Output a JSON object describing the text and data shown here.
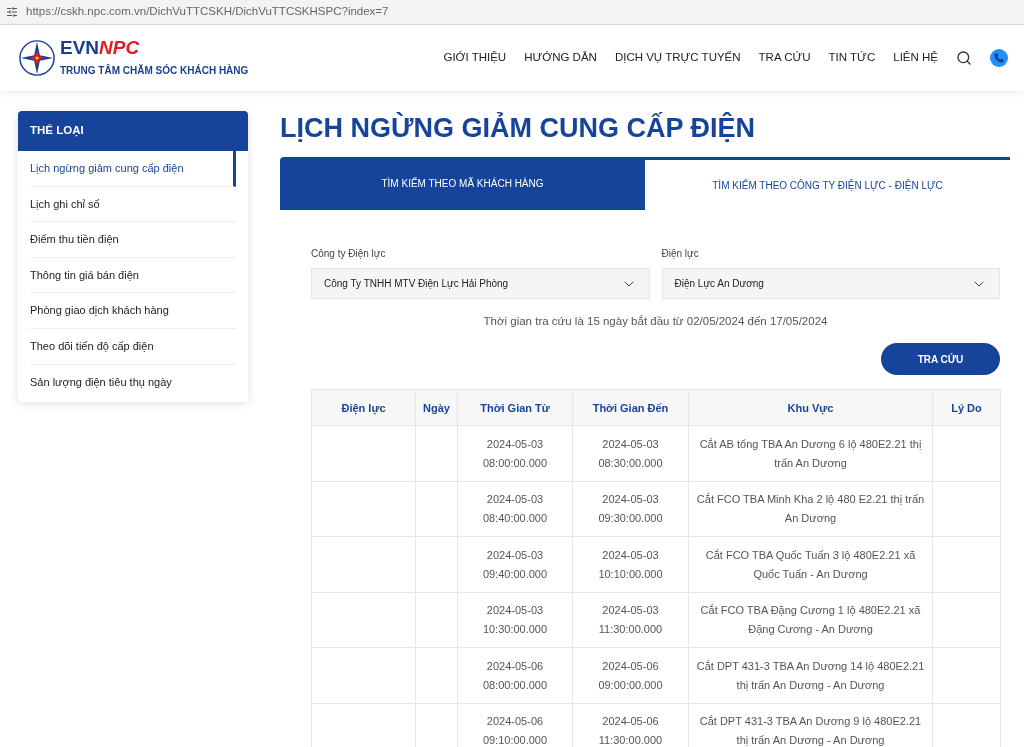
{
  "address_bar": {
    "url": "https://cskh.npc.com.vn/DichVuTTCSKH/DichVuTTCSKHSPC?index=7"
  },
  "header": {
    "logo_text_1": "EVN",
    "logo_text_2": "NPC",
    "subtitle": "TRUNG TÂM CHĂM SÓC KHÁCH HÀNG",
    "nav": [
      "GIỚI THIỆU",
      "HƯỚNG DẪN",
      "DỊCH VỤ TRỰC TUYẾN",
      "TRA CỨU",
      "TIN TỨC",
      "LIÊN HỆ"
    ]
  },
  "sidebar": {
    "title": "THỂ LOẠI",
    "items": [
      {
        "label": "Lịch ngừng giảm cung cấp điện",
        "selected": true
      },
      {
        "label": "Lịch ghi chỉ số",
        "selected": false
      },
      {
        "label": "Điểm thu tiền điện",
        "selected": false
      },
      {
        "label": "Thông tin giá bán điện",
        "selected": false
      },
      {
        "label": "Phòng giao dịch khách hàng",
        "selected": false
      },
      {
        "label": "Theo dõi tiến độ cấp điện",
        "selected": false
      },
      {
        "label": "Sản lượng điện tiêu thụ ngày",
        "selected": false
      }
    ]
  },
  "page_title": "LỊCH NGỪNG GIẢM CUNG CẤP ĐIỆN",
  "tabs": [
    {
      "label": "TÌM KIẾM THEO MÃ KHÁCH HÀNG",
      "selected": false
    },
    {
      "label": "TÌM KIẾM THEO CÔNG TY ĐIỆN LỰC - ĐIỆN LỰC",
      "selected": true
    }
  ],
  "form": {
    "fields": [
      {
        "label": "Công ty Điện lực",
        "value": "Công Ty TNHH MTV Điện Lực Hải Phòng"
      },
      {
        "label": "Điện lực",
        "value": "Điện Lực An Dương"
      }
    ],
    "note": "Thời gian tra cứu là 15 ngày bắt đầu từ 02/05/2024 đến 17/05/2024",
    "button": "TRA CỨU"
  },
  "table": {
    "columns": [
      "Điện lực",
      "Ngày",
      "Thời Gian Từ",
      "Thời Gian Đến",
      "Khu Vực",
      "Lý Do"
    ],
    "rows": [
      [
        "",
        "",
        "2024-05-03 08:00:00.000",
        "2024-05-03 08:30:00.000",
        "Cắt AB tổng TBA An Dương 6 lộ 480E2.21 thị trấn An Dương",
        ""
      ],
      [
        "",
        "",
        "2024-05-03 08:40:00.000",
        "2024-05-03 09:30:00.000",
        "Cắt FCO TBA Minh Kha 2 lộ 480 E2.21 thị trấn An Dương",
        ""
      ],
      [
        "",
        "",
        "2024-05-03 09:40:00.000",
        "2024-05-03 10:10:00.000",
        "Cắt FCO TBA Quốc Tuấn 3 lộ 480E2.21 xã Quốc Tuấn - An Dương",
        ""
      ],
      [
        "",
        "",
        "2024-05-03 10:30:00.000",
        "2024-05-03 11:30:00.000",
        "Cắt FCO TBA Đặng Cương 1 lộ 480E2.21 xã Đặng Cương - An Dương",
        ""
      ],
      [
        "",
        "",
        "2024-05-06 08:00:00.000",
        "2024-05-06 09:00:00.000",
        "Cắt DPT 431-3 TBA An Dương 14 lộ 480E2.21 thị trấn An Dương - An Dương",
        ""
      ],
      [
        "",
        "",
        "2024-05-06 09:10:00.000",
        "2024-05-06 11:30:00.000",
        "Cắt DPT 431-3 TBA An Dương 9 lộ 480E2.21 thị trấn An Dương - An Dương",
        ""
      ]
    ]
  }
}
